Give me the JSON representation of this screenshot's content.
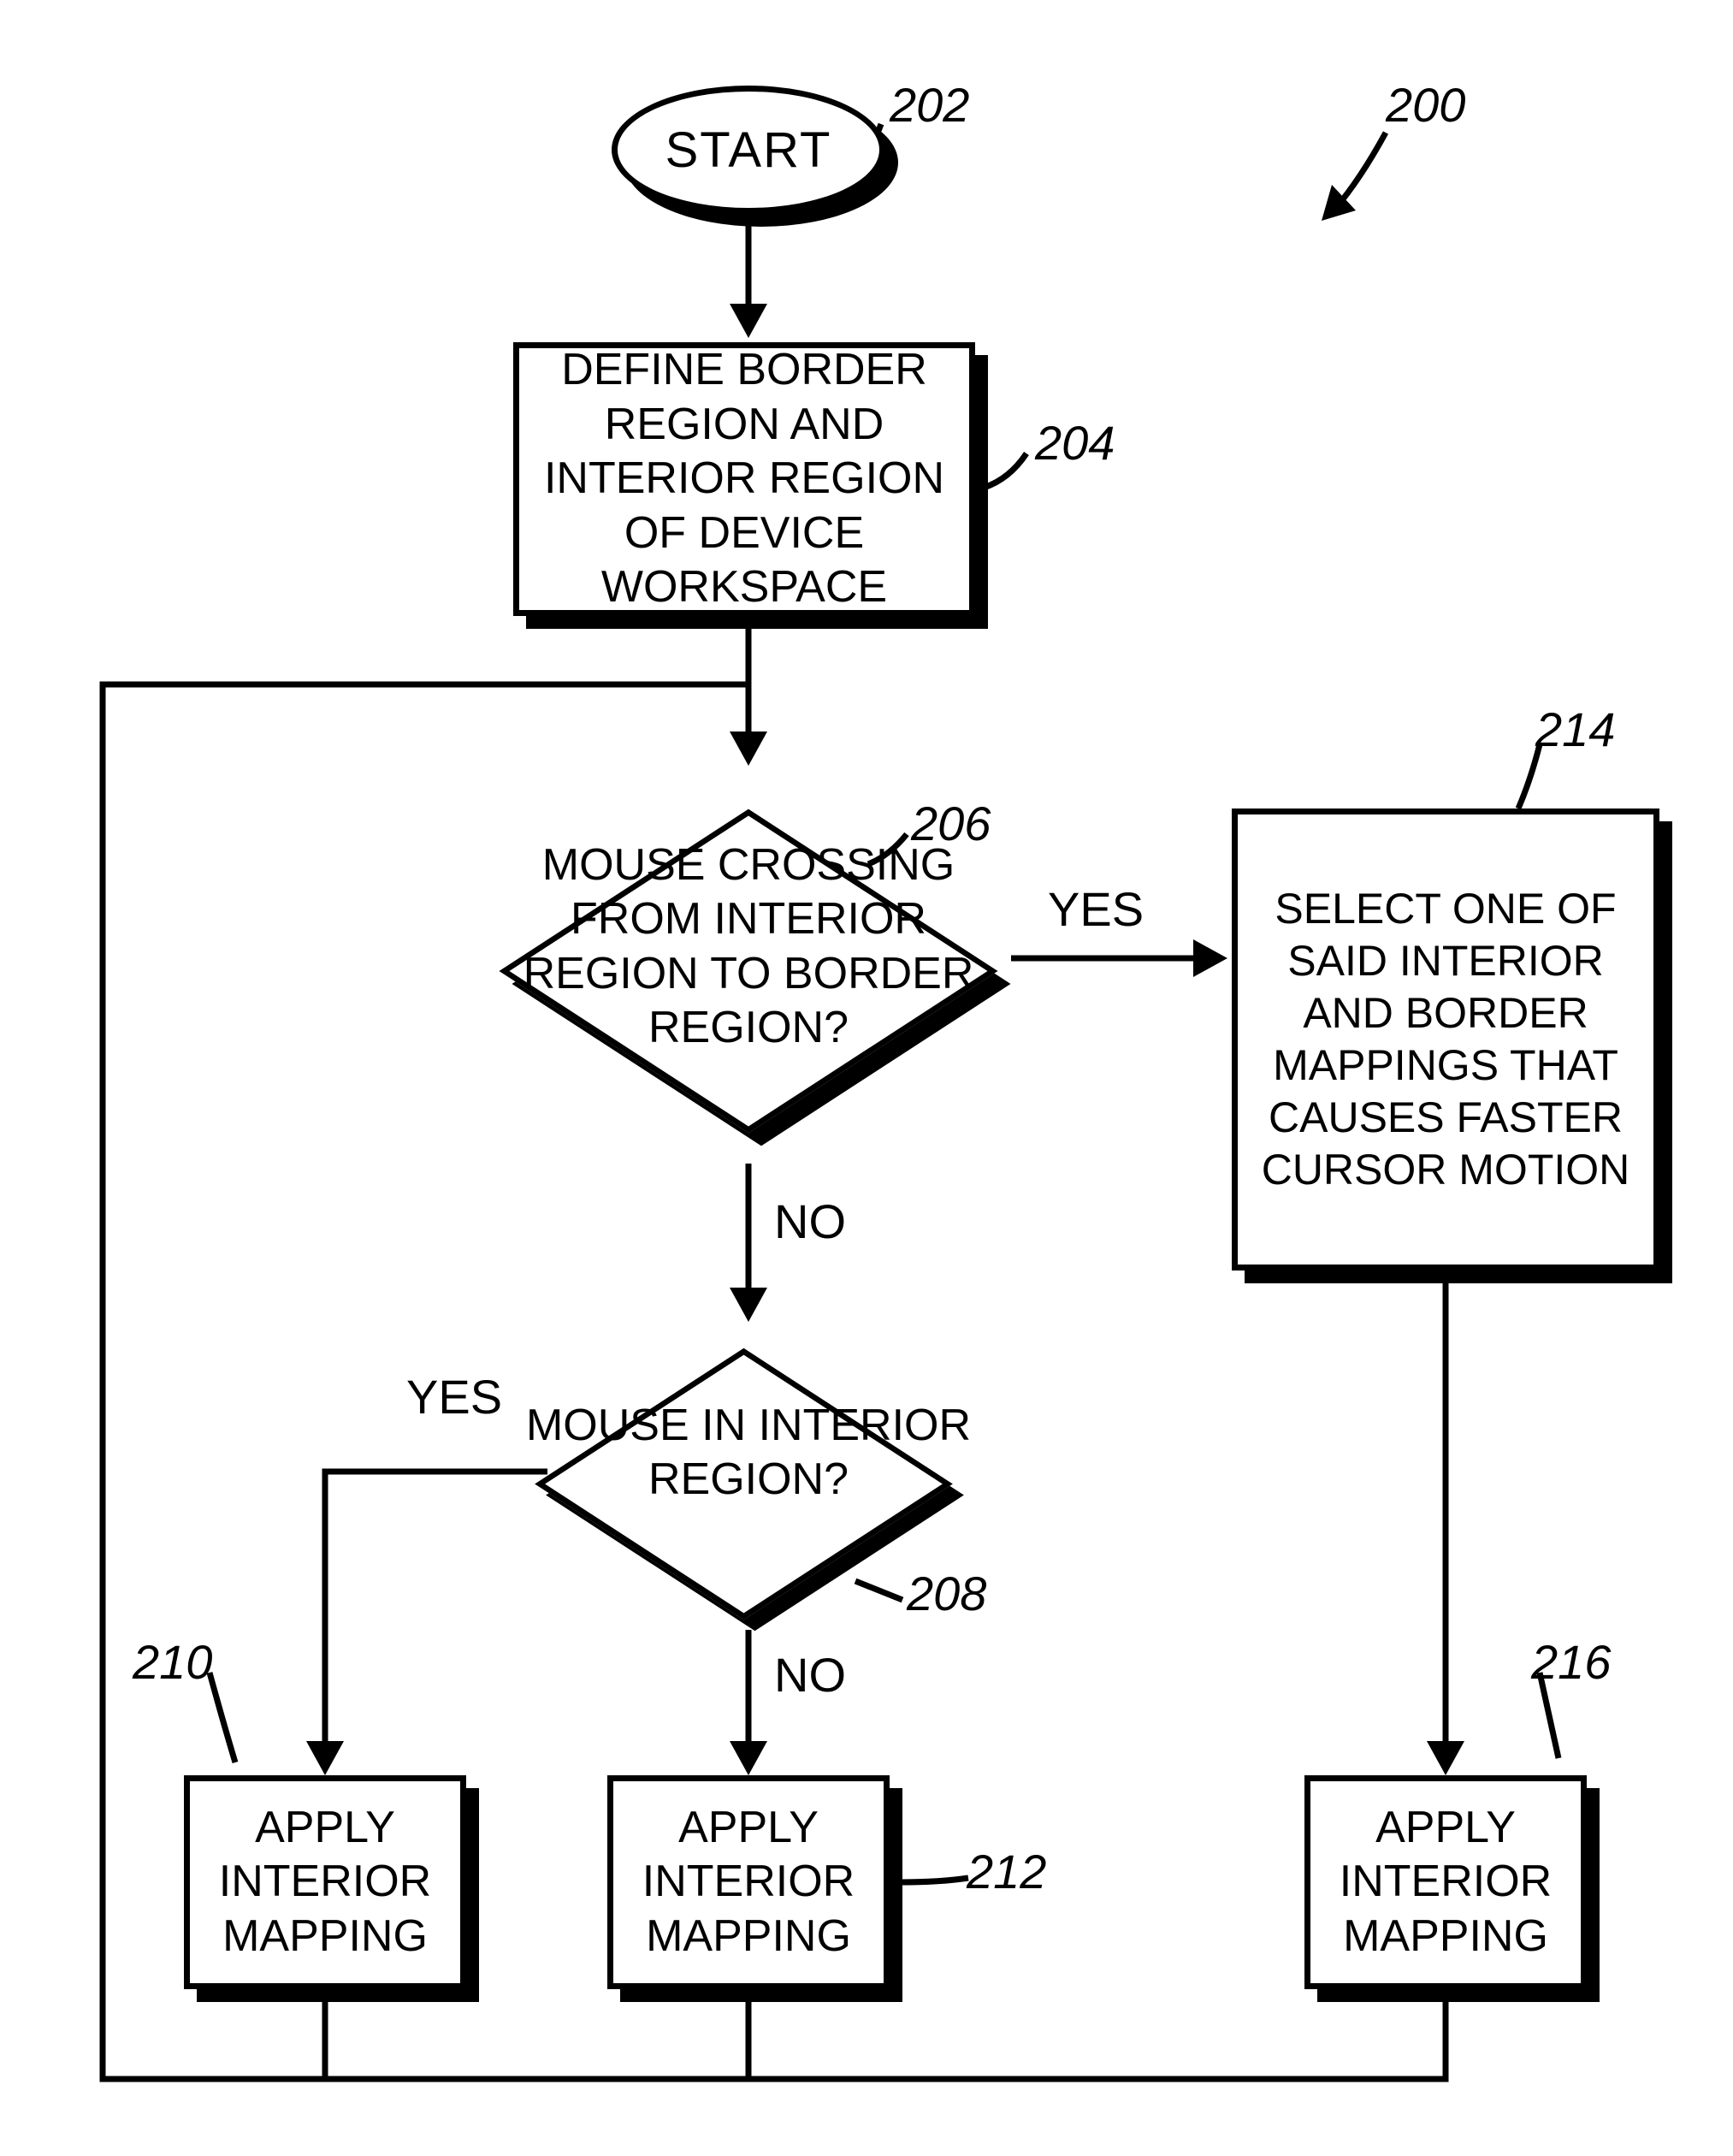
{
  "refs": {
    "overall": "200",
    "start": "202",
    "define": "204",
    "d1": "206",
    "d2": "208",
    "p210": "210",
    "p212": "212",
    "p214": "214",
    "p216": "216"
  },
  "text": {
    "start": "START",
    "define": "DEFINE BORDER REGION AND INTERIOR REGION OF DEVICE WORKSPACE",
    "d1": "MOUSE CROSSING FROM INTERIOR REGION TO BORDER REGION?",
    "d2": "MOUSE IN INTERIOR REGION?",
    "p210": "APPLY INTERIOR MAPPING",
    "p212": "APPLY INTERIOR MAPPING",
    "p214": "SELECT ONE OF SAID INTERIOR AND BORDER MAPPINGS THAT CAUSES FASTER CURSOR MOTION",
    "p216": "APPLY INTERIOR MAPPING",
    "yes": "YES",
    "no": "NO"
  }
}
